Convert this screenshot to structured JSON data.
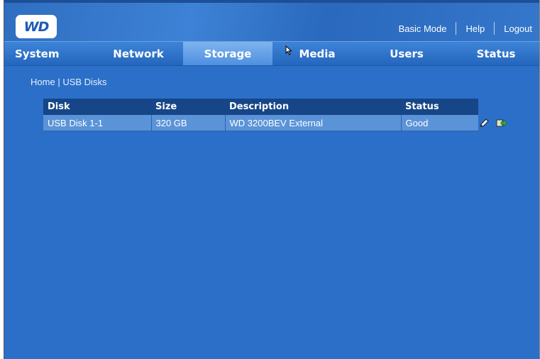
{
  "header": {
    "logo_text": "WD",
    "links": [
      "Basic Mode",
      "Help",
      "Logout"
    ]
  },
  "nav": {
    "tabs": [
      "System",
      "Network",
      "Storage",
      "Media",
      "Users",
      "Status"
    ],
    "active_tab": "Storage"
  },
  "breadcrumb": {
    "home": "Home",
    "separator": "|",
    "current": "USB Disks"
  },
  "table": {
    "headers": [
      "Disk",
      "Size",
      "Description",
      "Status"
    ],
    "rows": [
      [
        "USB Disk 1-1",
        "320 GB",
        "WD 3200BEV External",
        "Good"
      ]
    ]
  },
  "row_actions": [
    "edit-disk-icon",
    "eject-disk-icon"
  ],
  "colors": {
    "page_background": "#2b6fc8",
    "table_header": "#164687",
    "table_row": "#5b93d8",
    "active_tab": "#6aa6ea"
  }
}
